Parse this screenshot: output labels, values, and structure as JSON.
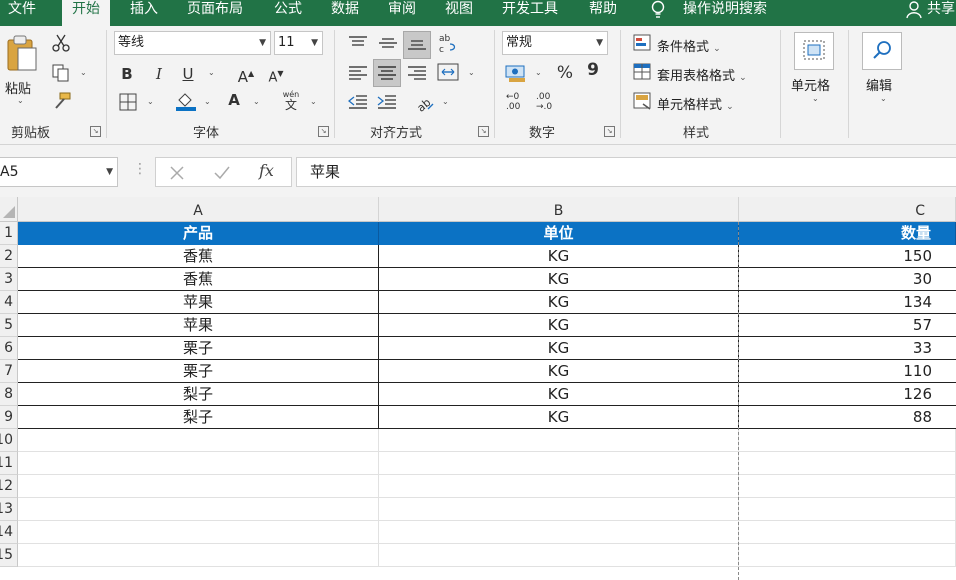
{
  "tabs": [
    "文件",
    "开始",
    "插入",
    "页面布局",
    "公式",
    "数据",
    "审阅",
    "视图",
    "开发工具",
    "帮助",
    "操作说明搜索",
    "共享"
  ],
  "ribbon": {
    "clipboard": {
      "paste": "粘贴",
      "label": "剪贴板"
    },
    "font": {
      "name": "等线",
      "size": "11",
      "label": "字体",
      "bold": "B",
      "italic": "I",
      "underline": "U",
      "grow": "A",
      "shrink": "A",
      "color_a": "A",
      "phonetic_top": "wén",
      "phonetic_bottom": "文"
    },
    "alignment": {
      "label": "对齐方式"
    },
    "number": {
      "format": "常规",
      "percent": "%",
      "comma": "9",
      "label": "数字",
      "inc_top": "←0",
      "inc_bottom": ".00",
      "dec_top": ".00",
      "dec_bottom": "→.0"
    },
    "styles": {
      "conditional": "条件格式",
      "table": "套用表格格式",
      "cell_styles": "单元格样式",
      "label": "样式"
    },
    "cells": {
      "label": "单元格"
    },
    "editing": {
      "label": "编辑"
    }
  },
  "formula_bar": {
    "name_box": "A5",
    "value": "苹果",
    "fx": "fx"
  },
  "columns": [
    "A",
    "B",
    "C"
  ],
  "rows": [
    "1",
    "2",
    "3",
    "4",
    "5",
    "6",
    "7",
    "8",
    "9",
    "10",
    "11",
    "12",
    "13",
    "14",
    "15"
  ],
  "table": {
    "headers": [
      "产品",
      "单位",
      "数量"
    ],
    "rows": [
      [
        "香蕉",
        "KG",
        "150"
      ],
      [
        "香蕉",
        "KG",
        "30"
      ],
      [
        "苹果",
        "KG",
        "134"
      ],
      [
        "苹果",
        "KG",
        "57"
      ],
      [
        "栗子",
        "KG",
        "33"
      ],
      [
        "栗子",
        "KG",
        "110"
      ],
      [
        "梨子",
        "KG",
        "126"
      ],
      [
        "梨子",
        "KG",
        "88"
      ]
    ]
  },
  "colors": {
    "excel_green": "#217346",
    "header_blue": "#0b72c4"
  }
}
